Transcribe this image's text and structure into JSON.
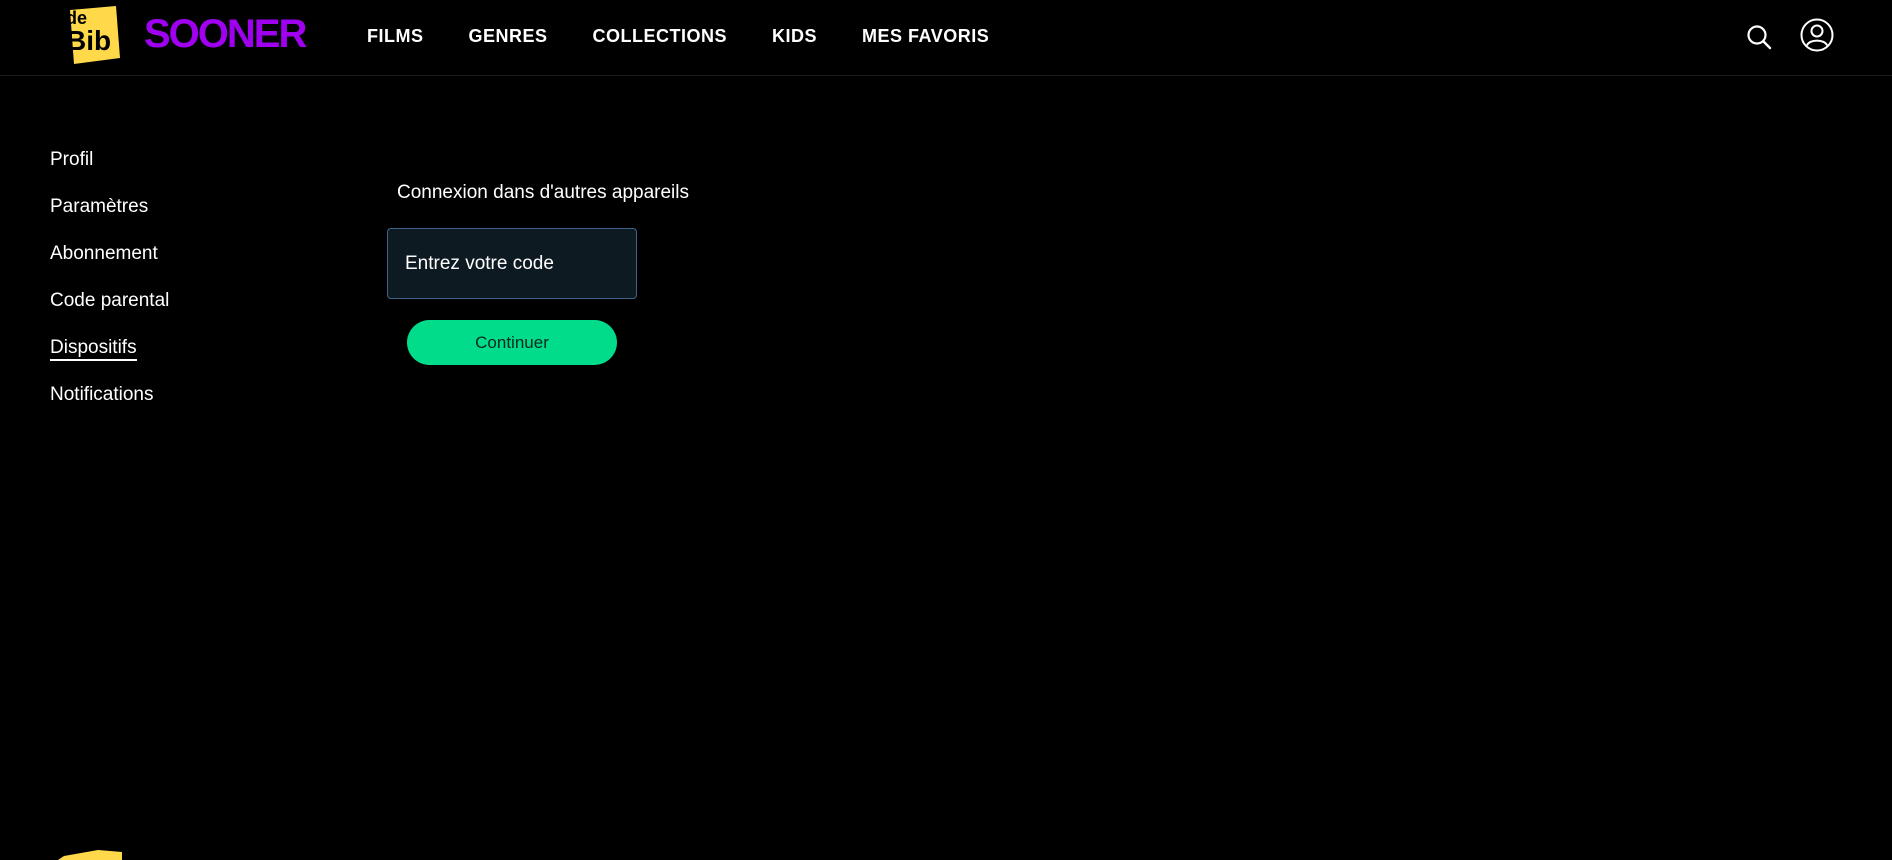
{
  "brand": {
    "bib_logo_text": "de Bib",
    "sooner_logo_text": "SOONER",
    "colors": {
      "bib_yellow": "#ffd94a",
      "sooner_purple": "#a000f0",
      "accent_green": "#00dc8a",
      "input_border": "#41618a",
      "input_bg": "#0e1a22"
    }
  },
  "nav": {
    "items": [
      {
        "label": "FILMS"
      },
      {
        "label": "GENRES"
      },
      {
        "label": "COLLECTIONS"
      },
      {
        "label": "KIDS"
      },
      {
        "label": "MES FAVORIS"
      }
    ]
  },
  "header_icons": {
    "search": "search-icon",
    "account": "user-circle-icon"
  },
  "sidebar": {
    "items": [
      {
        "label": "Profil"
      },
      {
        "label": "Paramètres"
      },
      {
        "label": "Abonnement"
      },
      {
        "label": "Code parental"
      },
      {
        "label": "Dispositifs",
        "active": true
      },
      {
        "label": "Notifications"
      }
    ]
  },
  "main": {
    "title": "Connexion dans d'autres appareils",
    "code_input": {
      "value": "",
      "placeholder": "Entrez votre code"
    },
    "continue_label": "Continuer"
  }
}
